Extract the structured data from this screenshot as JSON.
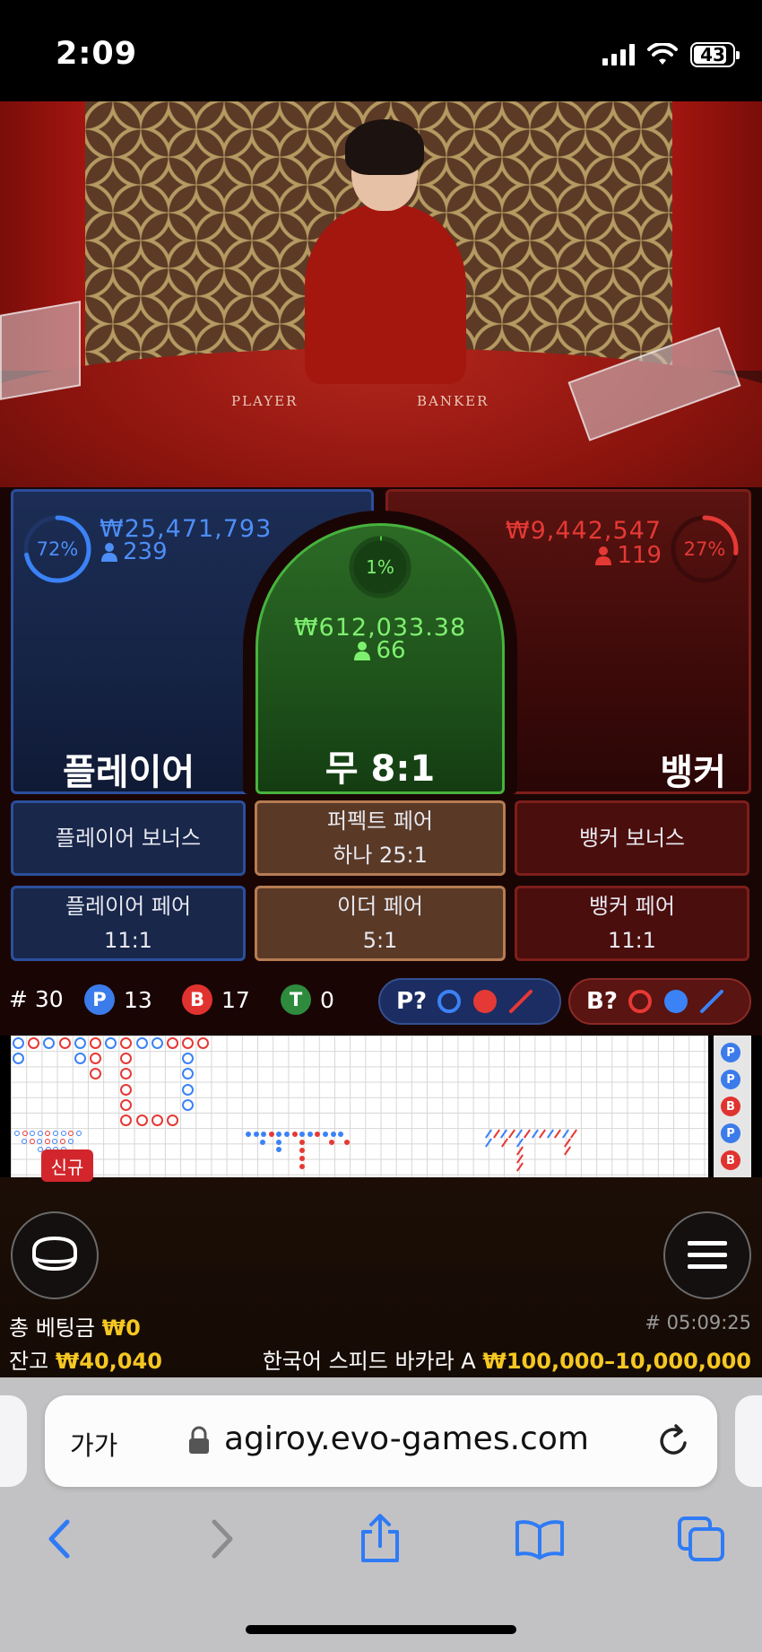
{
  "status_bar": {
    "time": "2:09",
    "battery": "43"
  },
  "video": {
    "player_mark": "PLAYER",
    "banker_mark": "BANKER"
  },
  "player": {
    "percent": "72%",
    "amount": "₩25,471,793",
    "bettors": "239",
    "label": "플레이어"
  },
  "tie": {
    "percent": "1%",
    "amount": "₩612,033.38",
    "bettors": "66",
    "label": "무 8:1"
  },
  "banker": {
    "percent": "27%",
    "amount": "₩9,442,547",
    "bettors": "119",
    "label": "뱅커"
  },
  "side_bets": {
    "player_bonus": "플레이어 보너스",
    "perfect_pair_line1": "퍼펙트 페어",
    "perfect_pair_line2": "하나 25:1",
    "banker_bonus": "뱅커 보너스",
    "player_pair_line1": "플레이어 페어",
    "player_pair_line2": "11:1",
    "either_pair_line1": "이더 페어",
    "either_pair_line2": "5:1",
    "banker_pair_line1": "뱅커 페어",
    "banker_pair_line2": "11:1"
  },
  "stats": {
    "round": "# 30",
    "p_label": "P",
    "p_count": "13",
    "b_label": "B",
    "b_count": "17",
    "t_label": "T",
    "t_count": "0",
    "predict_p": "P?",
    "predict_b": "B?"
  },
  "roadmap_side": [
    "P",
    "P",
    "B",
    "P",
    "B"
  ],
  "bottom": {
    "new_badge": "신규",
    "total_bet_label": "총 베팅금",
    "total_bet_value": "₩0",
    "balance_label": "잔고",
    "balance_value": "₩40,040",
    "game_id": "# 05:09:25",
    "table_name": "한국어 스피드 바카라 A",
    "limits": "₩100,000–10,000,000"
  },
  "browser": {
    "text_size": "가가",
    "url": "agiroy.evo-games.com"
  },
  "colors": {
    "player_blue": "#3b82f6",
    "banker_red": "#e53935",
    "tie_green": "#2e8b3e",
    "gold": "#f5c721"
  }
}
